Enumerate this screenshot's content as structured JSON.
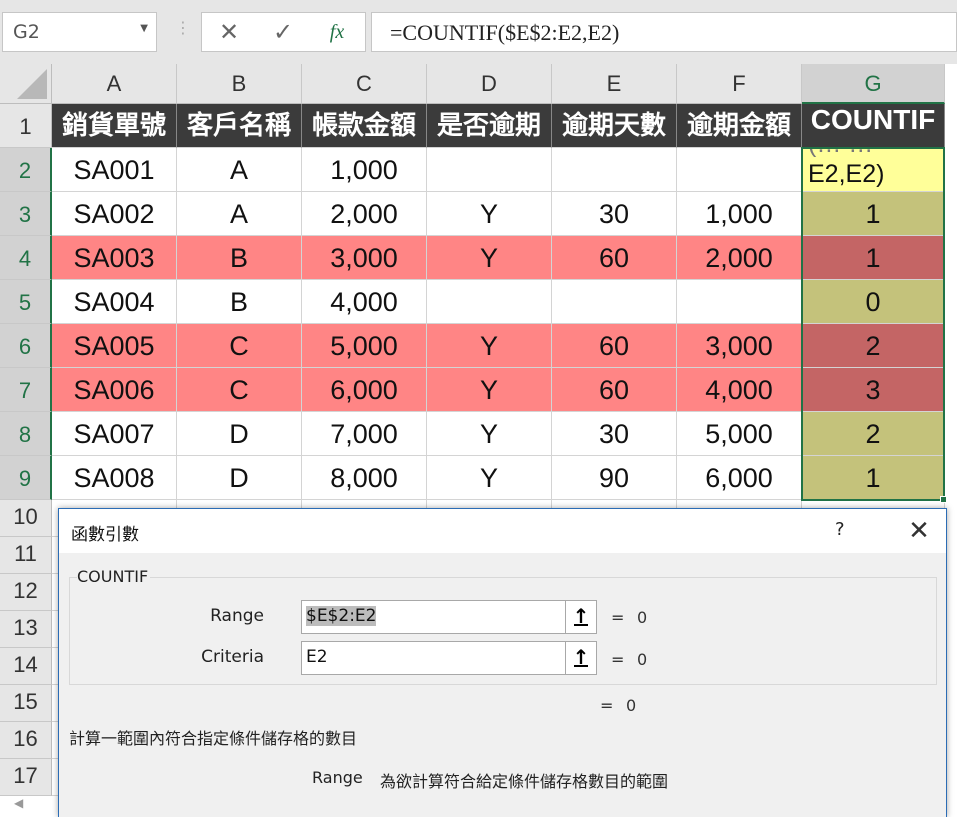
{
  "formula_bar": {
    "name_box": "G2",
    "cancel_icon": "✕",
    "enter_icon": "✓",
    "function_icon": "fx",
    "formula": "=COUNTIF($E$2:E2,E2)"
  },
  "columns": [
    "A",
    "B",
    "C",
    "D",
    "E",
    "F",
    "G"
  ],
  "rows": [
    "1",
    "2",
    "3",
    "4",
    "5",
    "6",
    "7",
    "8",
    "9",
    "10",
    "11",
    "12",
    "13",
    "14",
    "15",
    "16",
    "17"
  ],
  "header_row": [
    "銷貨單號",
    "客戶名稱",
    "帳款金額",
    "是否逾期",
    "逾期天數",
    "逾期金額",
    "COUNTIF"
  ],
  "data_rows": [
    {
      "id": "SA001",
      "client": "A",
      "amount": "1,000",
      "overdue": "",
      "days": "",
      "overdue_amount": "",
      "countif": "E2,E2)",
      "style": "normal"
    },
    {
      "id": "SA002",
      "client": "A",
      "amount": "2,000",
      "overdue": "Y",
      "days": "30",
      "overdue_amount": "1,000",
      "countif": "1",
      "style": "normal"
    },
    {
      "id": "SA003",
      "client": "B",
      "amount": "3,000",
      "overdue": "Y",
      "days": "60",
      "overdue_amount": "2,000",
      "countif": "1",
      "style": "highlight"
    },
    {
      "id": "SA004",
      "client": "B",
      "amount": "4,000",
      "overdue": "",
      "days": "",
      "overdue_amount": "",
      "countif": "0",
      "style": "normal"
    },
    {
      "id": "SA005",
      "client": "C",
      "amount": "5,000",
      "overdue": "Y",
      "days": "60",
      "overdue_amount": "3,000",
      "countif": "2",
      "style": "highlight"
    },
    {
      "id": "SA006",
      "client": "C",
      "amount": "6,000",
      "overdue": "Y",
      "days": "60",
      "overdue_amount": "4,000",
      "countif": "3",
      "style": "highlight"
    },
    {
      "id": "SA007",
      "client": "D",
      "amount": "7,000",
      "overdue": "Y",
      "days": "30",
      "overdue_amount": "5,000",
      "countif": "2",
      "style": "normal"
    },
    {
      "id": "SA008",
      "client": "D",
      "amount": "8,000",
      "overdue": "Y",
      "days": "90",
      "overdue_amount": "6,000",
      "countif": "1",
      "style": "normal"
    }
  ],
  "g2_ghost_text": "(…  …",
  "dialog": {
    "title": "函數引數",
    "help": "?",
    "close": "✕",
    "function_name": "COUNTIF",
    "args": [
      {
        "label": "Range",
        "value": "$E$2:E2",
        "eq": "=",
        "result": "0"
      },
      {
        "label": "Criteria",
        "value": "E2",
        "eq": "=",
        "result": "0"
      }
    ],
    "result_eq": "=",
    "result_value": "0",
    "description": "計算一範圍內符合指定條件儲存格的數目",
    "arg_desc_name": "Range",
    "arg_desc_text": "為欲計算符合給定條件儲存格數目的範圍",
    "ref_button_icon": "↑"
  },
  "colors": {
    "header_bg": "#3b3b3b",
    "highlight_row": "#ff8585",
    "countif_fill": "#c4c27b",
    "countif_highlight": "#c46565",
    "editing_cell": "#ffff99",
    "selection": "#217346"
  }
}
